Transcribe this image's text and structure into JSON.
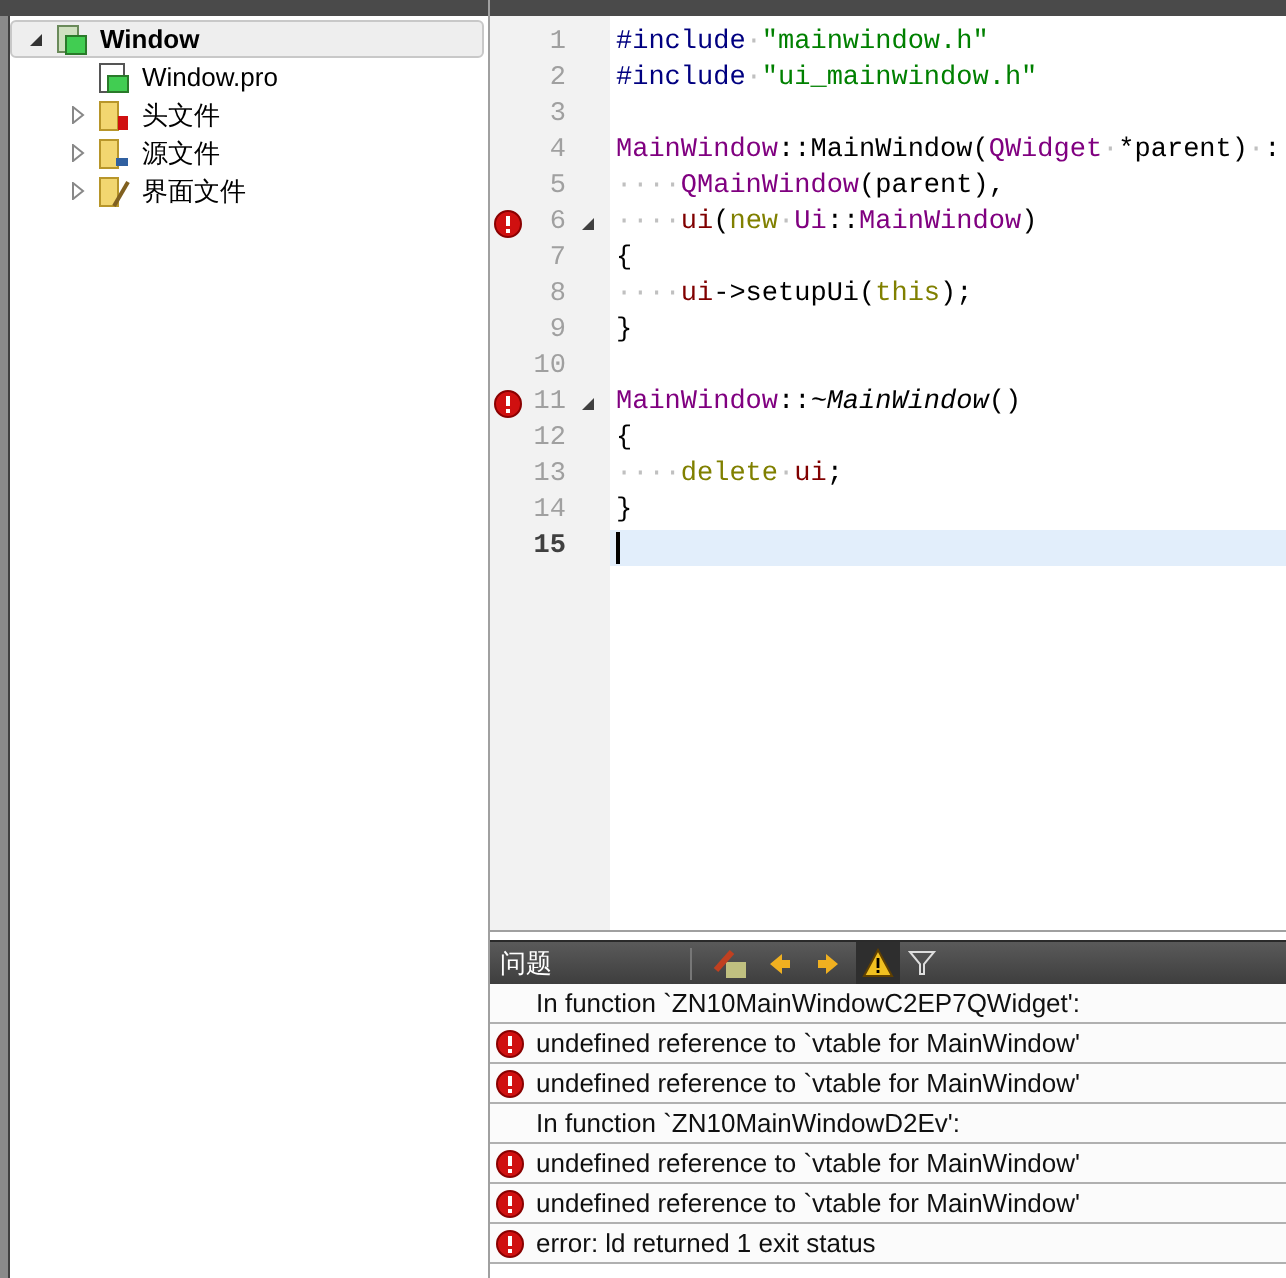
{
  "project_tree": {
    "root": {
      "label": "Window",
      "kind": "project",
      "expanded": true,
      "selected": true,
      "children": [
        {
          "label": "Window.pro",
          "kind": "pro-file"
        },
        {
          "label": "头文件",
          "kind": "header-folder",
          "expanded": false
        },
        {
          "label": "源文件",
          "kind": "source-folder",
          "expanded": false
        },
        {
          "label": "界面文件",
          "kind": "forms-folder",
          "expanded": false
        }
      ]
    }
  },
  "editor": {
    "lines": [
      {
        "number": "1",
        "error": false,
        "fold": false,
        "current": false,
        "tokens": [
          {
            "kind": "preproc",
            "text": "#include"
          },
          {
            "kind": "ws",
            "text": "·"
          },
          {
            "kind": "string",
            "text": "\"mainwindow.h\""
          }
        ]
      },
      {
        "number": "2",
        "error": false,
        "fold": false,
        "current": false,
        "tokens": [
          {
            "kind": "preproc",
            "text": "#include"
          },
          {
            "kind": "ws",
            "text": "·"
          },
          {
            "kind": "string",
            "text": "\"ui_mainwindow.h\""
          }
        ]
      },
      {
        "number": "3",
        "error": false,
        "fold": false,
        "current": false
      },
      {
        "number": "4",
        "error": false,
        "fold": false,
        "current": false,
        "tokens": [
          {
            "kind": "type",
            "text": "MainWindow"
          },
          {
            "kind": "plain",
            "text": "::MainWindow("
          },
          {
            "kind": "type",
            "text": "QWidget"
          },
          {
            "kind": "ws",
            "text": "·"
          },
          {
            "kind": "plain",
            "text": "*parent)"
          },
          {
            "kind": "ws",
            "text": "·"
          },
          {
            "kind": "plain",
            "text": ":"
          }
        ]
      },
      {
        "number": "5",
        "error": false,
        "fold": false,
        "current": false,
        "tokens": [
          {
            "kind": "ws",
            "text": "····"
          },
          {
            "kind": "type",
            "text": "QMainWindow"
          },
          {
            "kind": "plain",
            "text": "(parent),"
          }
        ]
      },
      {
        "number": "6",
        "error": true,
        "fold": true,
        "current": false,
        "tokens": [
          {
            "kind": "ws",
            "text": "····"
          },
          {
            "kind": "member",
            "text": "ui"
          },
          {
            "kind": "plain",
            "text": "("
          },
          {
            "kind": "keyword",
            "text": "new"
          },
          {
            "kind": "ws",
            "text": "·"
          },
          {
            "kind": "type",
            "text": "Ui"
          },
          {
            "kind": "plain",
            "text": "::"
          },
          {
            "kind": "type",
            "text": "MainWindow"
          },
          {
            "kind": "plain",
            "text": ")"
          }
        ]
      },
      {
        "number": "7",
        "error": false,
        "fold": false,
        "current": false,
        "tokens": [
          {
            "kind": "plain",
            "text": "{"
          }
        ]
      },
      {
        "number": "8",
        "error": false,
        "fold": false,
        "current": false,
        "tokens": [
          {
            "kind": "ws",
            "text": "····"
          },
          {
            "kind": "member",
            "text": "ui"
          },
          {
            "kind": "plain",
            "text": "->setupUi("
          },
          {
            "kind": "keyword",
            "text": "this"
          },
          {
            "kind": "plain",
            "text": ");"
          }
        ]
      },
      {
        "number": "9",
        "error": false,
        "fold": false,
        "current": false,
        "tokens": [
          {
            "kind": "plain",
            "text": "}"
          }
        ]
      },
      {
        "number": "10",
        "error": false,
        "fold": false,
        "current": false
      },
      {
        "number": "11",
        "error": true,
        "fold": true,
        "current": false,
        "tokens": [
          {
            "kind": "type",
            "text": "MainWindow"
          },
          {
            "kind": "plain",
            "text": "::"
          },
          {
            "kind": "italic",
            "text": "~MainWindow"
          },
          {
            "kind": "plain",
            "text": "()"
          }
        ]
      },
      {
        "number": "12",
        "error": false,
        "fold": false,
        "current": false,
        "tokens": [
          {
            "kind": "plain",
            "text": "{"
          }
        ]
      },
      {
        "number": "13",
        "error": false,
        "fold": false,
        "current": false,
        "tokens": [
          {
            "kind": "ws",
            "text": "····"
          },
          {
            "kind": "keyword",
            "text": "delete"
          },
          {
            "kind": "ws",
            "text": "·"
          },
          {
            "kind": "member",
            "text": "ui"
          },
          {
            "kind": "plain",
            "text": ";"
          }
        ]
      },
      {
        "number": "14",
        "error": false,
        "fold": false,
        "current": false,
        "tokens": [
          {
            "kind": "plain",
            "text": "}"
          }
        ]
      },
      {
        "number": "15",
        "error": false,
        "fold": false,
        "current": true
      }
    ]
  },
  "issues": {
    "title": "问题",
    "rows": [
      {
        "kind": "context",
        "text": "In function `ZN10MainWindowC2EP7QWidget':"
      },
      {
        "kind": "error",
        "text": "undefined reference to `vtable for MainWindow'"
      },
      {
        "kind": "error",
        "text": "undefined reference to `vtable for MainWindow'"
      },
      {
        "kind": "context",
        "text": "In function `ZN10MainWindowD2Ev':"
      },
      {
        "kind": "error",
        "text": "undefined reference to `vtable for MainWindow'"
      },
      {
        "kind": "error",
        "text": "undefined reference to `vtable for MainWindow'"
      },
      {
        "kind": "error",
        "text": "error: ld returned 1 exit status"
      }
    ]
  }
}
